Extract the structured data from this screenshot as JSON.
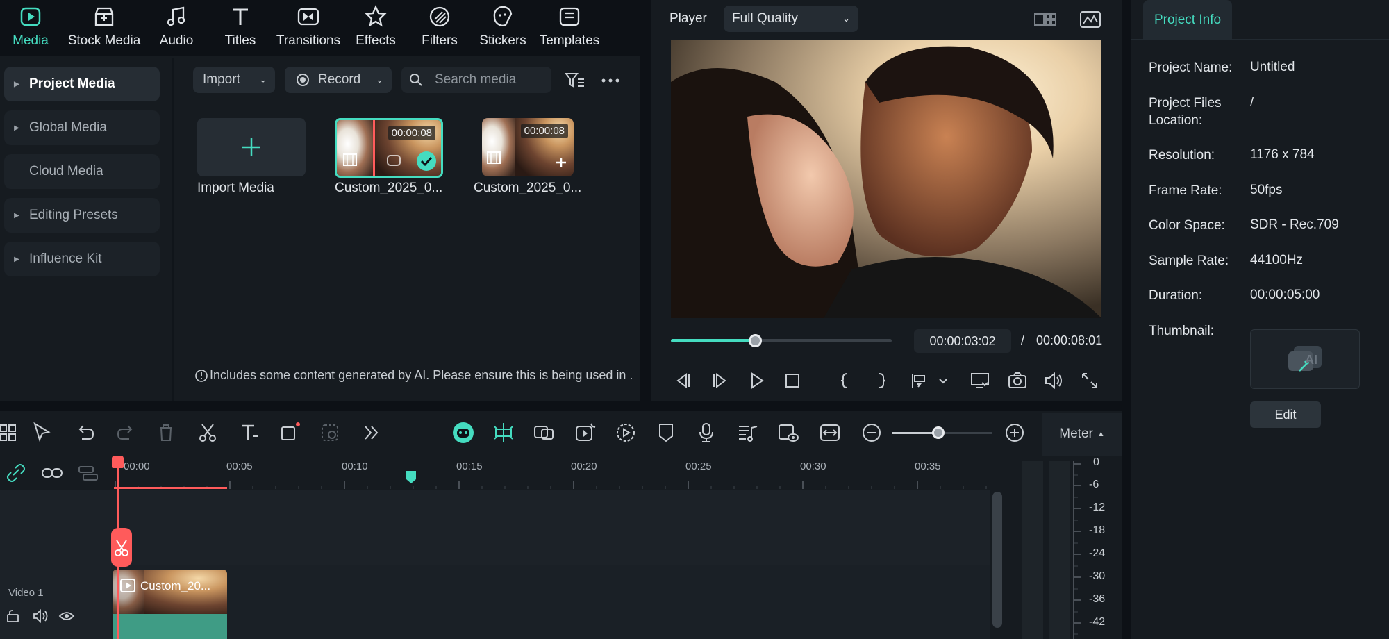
{
  "top_nav": [
    {
      "label": "Media",
      "icon": "media-icon",
      "active": true
    },
    {
      "label": "Stock Media",
      "icon": "stock-media-icon"
    },
    {
      "label": "Audio",
      "icon": "audio-icon"
    },
    {
      "label": "Titles",
      "icon": "titles-icon"
    },
    {
      "label": "Transitions",
      "icon": "transitions-icon"
    },
    {
      "label": "Effects",
      "icon": "effects-icon"
    },
    {
      "label": "Filters",
      "icon": "filters-icon"
    },
    {
      "label": "Stickers",
      "icon": "stickers-icon"
    },
    {
      "label": "Templates",
      "icon": "templates-icon"
    }
  ],
  "sidebar": {
    "items": [
      {
        "label": "Project Media",
        "active": true,
        "expandable": true
      },
      {
        "label": "Global Media",
        "expandable": true
      },
      {
        "label": "Cloud Media",
        "expandable": false
      },
      {
        "label": "Editing Presets",
        "expandable": true
      },
      {
        "label": "Influence Kit",
        "expandable": true
      }
    ]
  },
  "media_toolbar": {
    "import_label": "Import",
    "record_label": "Record",
    "search_placeholder": "Search media"
  },
  "media_items": {
    "import_label": "Import Media",
    "clips": [
      {
        "name": "Custom_2025_0...",
        "duration": "00:00:08",
        "selected": true
      },
      {
        "name": "Custom_2025_0...",
        "duration": "00:00:08",
        "selected": false
      }
    ]
  },
  "ai_notice": "Includes some content generated by AI. Please ensure this is being used in .",
  "player": {
    "title": "Player",
    "quality": "Full Quality",
    "current_time": "00:00:03:02",
    "separator": "/",
    "total_time": "00:00:08:01",
    "progress": 0.38
  },
  "project_info": {
    "tab": "Project Info",
    "rows": [
      {
        "label": "Project Name:",
        "value": "Untitled"
      },
      {
        "label": "Project Files Location:",
        "value": "/"
      },
      {
        "label": "Resolution:",
        "value": "1176 x 784"
      },
      {
        "label": "Frame Rate:",
        "value": "50fps"
      },
      {
        "label": "Color Space:",
        "value": "SDR - Rec.709"
      },
      {
        "label": "Sample Rate:",
        "value": "44100Hz"
      },
      {
        "label": "Duration:",
        "value": "00:00:05:00"
      },
      {
        "label": "Thumbnail:",
        "value": ""
      }
    ],
    "edit_label": "Edit"
  },
  "timeline": {
    "ticks": [
      "00:00",
      "00:05",
      "00:10",
      "00:15",
      "00:20",
      "00:25",
      "00:30",
      "00:35"
    ],
    "track_label": "Video 1",
    "clip_name": "Custom_20...",
    "meter_label": "Meter",
    "meter_scale": [
      "0",
      "-6",
      "-12",
      "-18",
      "-24",
      "-30",
      "-36",
      "-42"
    ]
  },
  "colors": {
    "accent": "#45dcc0",
    "playhead": "#ff5b5b",
    "panel": "#161b20"
  }
}
